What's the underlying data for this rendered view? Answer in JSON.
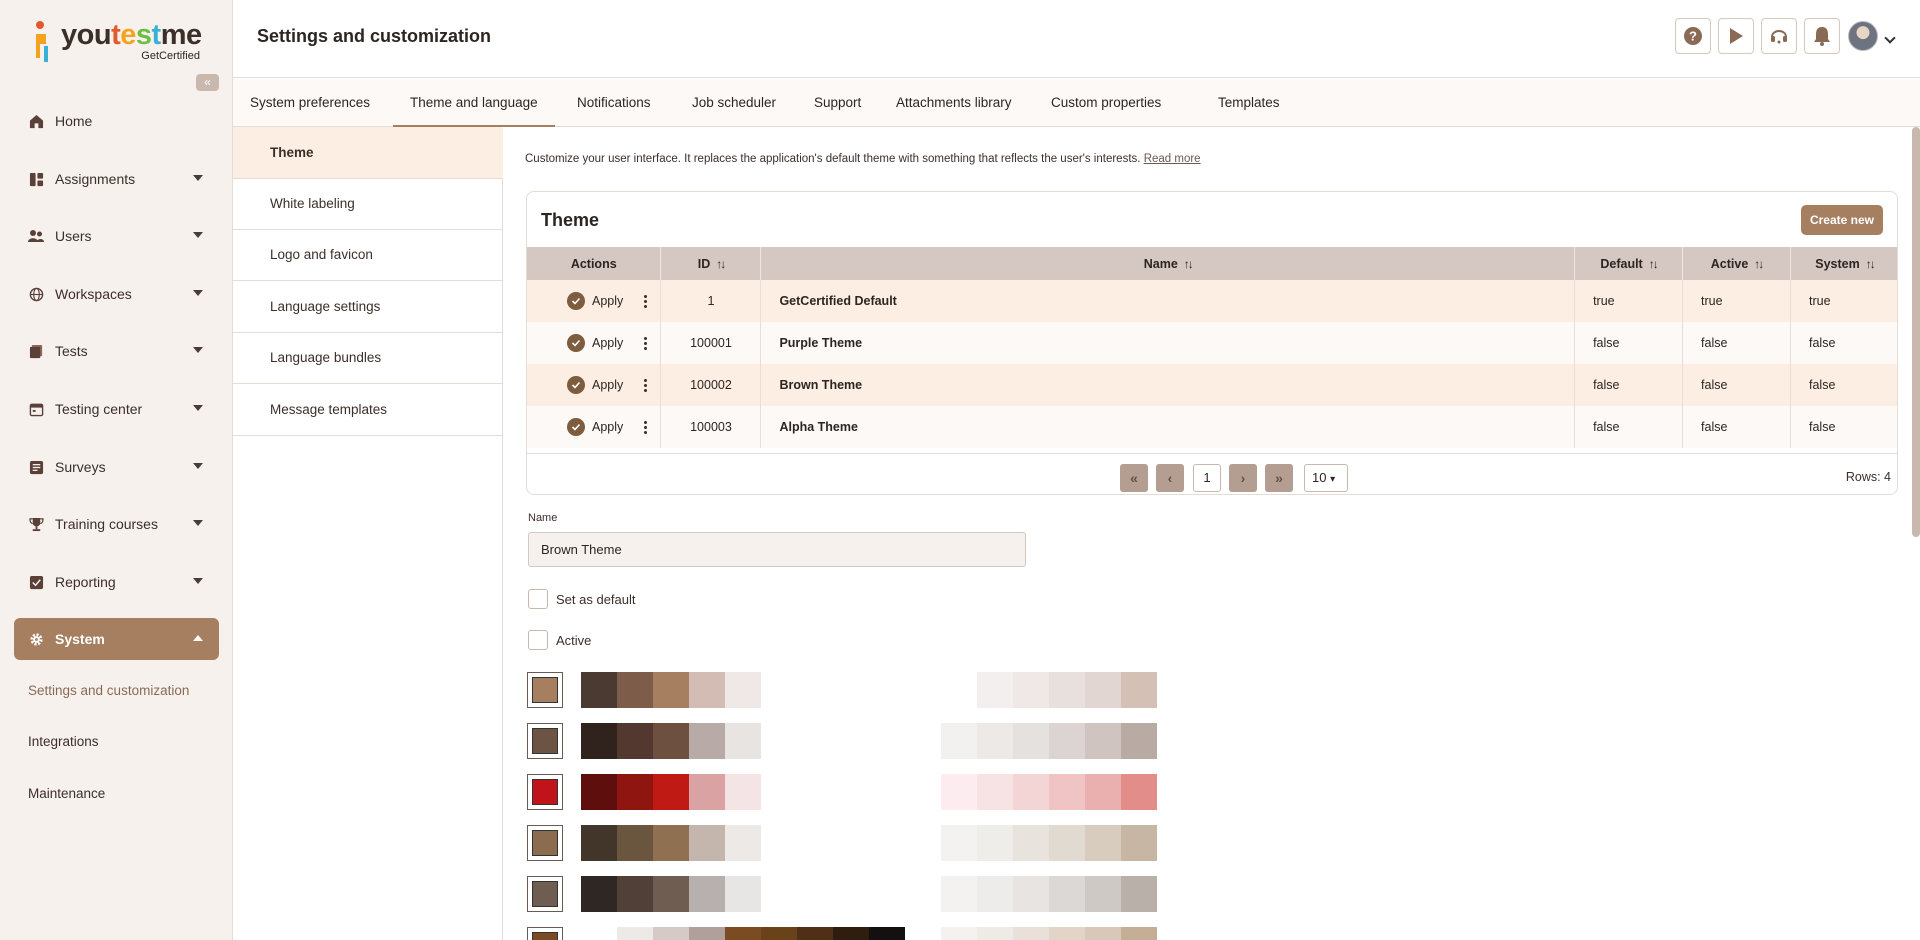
{
  "logo": {
    "text": "youtestme",
    "sub": "GetCertified"
  },
  "sidebar": {
    "items": [
      {
        "label": "Home",
        "icon": "home-icon"
      },
      {
        "label": "Assignments",
        "icon": "assignments-icon"
      },
      {
        "label": "Users",
        "icon": "users-icon"
      },
      {
        "label": "Workspaces",
        "icon": "globe-icon"
      },
      {
        "label": "Tests",
        "icon": "tests-icon"
      },
      {
        "label": "Testing center",
        "icon": "calendar-icon"
      },
      {
        "label": "Surveys",
        "icon": "survey-icon"
      },
      {
        "label": "Training courses",
        "icon": "trophy-icon"
      },
      {
        "label": "Reporting",
        "icon": "reporting-icon"
      },
      {
        "label": "System",
        "icon": "gear-icon"
      }
    ],
    "system_sub": [
      "Settings and customization",
      "Integrations",
      "Maintenance"
    ]
  },
  "header": {
    "title": "Settings and customization"
  },
  "tabs": [
    "System preferences",
    "Theme and language",
    "Notifications",
    "Job scheduler",
    "Support",
    "Attachments library",
    "Custom properties",
    "Templates"
  ],
  "subnav": [
    "Theme",
    "White labeling",
    "Logo and favicon",
    "Language settings",
    "Language bundles",
    "Message templates"
  ],
  "desc": {
    "text": "Customize your user interface. It replaces the application's default theme with something that reflects the user's interests.",
    "link": "Read more"
  },
  "theme_card": {
    "title": "Theme",
    "create_label": "Create new",
    "columns": [
      "Actions",
      "ID",
      "Name",
      "Default",
      "Active",
      "System"
    ],
    "apply_label": "Apply",
    "rows": [
      {
        "id": "1",
        "name": "GetCertified Default",
        "default": "true",
        "active": "true",
        "system": "true"
      },
      {
        "id": "100001",
        "name": "Purple Theme",
        "default": "false",
        "active": "false",
        "system": "false"
      },
      {
        "id": "100002",
        "name": "Brown Theme",
        "default": "false",
        "active": "false",
        "system": "false"
      },
      {
        "id": "100003",
        "name": "Alpha Theme",
        "default": "false",
        "active": "false",
        "system": "false"
      }
    ],
    "page": "1",
    "page_size": "10",
    "rows_count": "Rows: 4"
  },
  "form": {
    "name_label": "Name",
    "name_value": "Brown Theme",
    "set_default_label": "Set as default",
    "active_label": "Active"
  },
  "palettes": [
    {
      "main": "#a67f61",
      "dark": [
        "#4a3a31",
        "#7d5d49",
        "#a67f61",
        "#d2bcb3",
        "#efe8e6"
      ],
      "light": [
        "#f3efee",
        "#efe8e6",
        "#e7e0dd",
        "#e1d6d1",
        "#d5c0b5"
      ]
    },
    {
      "main": "#6d5344",
      "dark": [
        "#30231e",
        "#53382f",
        "#6d5040",
        "#b8aaa6",
        "#e8e4e2"
      ],
      "light": [
        "#f3f1f0",
        "#ece9e7",
        "#e5e1df",
        "#dbd4d2",
        "#cfc4c0",
        "#b9aaa4"
      ]
    },
    {
      "main": "#c0141a",
      "dark": [
        "#5e0e0c",
        "#8f1511",
        "#c01a14",
        "#dba2a4",
        "#f5e4e5"
      ],
      "light": [
        "#fcecef",
        "#f7e3e4",
        "#f4d5d6",
        "#f0c4c5",
        "#eaafaf",
        "#e28d89"
      ]
    },
    {
      "main": "#8b6c4e",
      "dark": [
        "#42352a",
        "#6a553f",
        "#8f7152",
        "#c5b6ad",
        "#ece9e7"
      ],
      "light": [
        "#f3f2f0",
        "#efede9",
        "#e8e3dd",
        "#e1dad1",
        "#d8ccbf",
        "#c7b6a4"
      ]
    },
    {
      "main": "#6f5d52",
      "dark": [
        "#2f2724",
        "#504038",
        "#6f5d52",
        "#b7b0ae",
        "#e8e6e5"
      ],
      "light": [
        "#f3f2f1",
        "#eeecea",
        "#e7e4e2",
        "#dcd8d6",
        "#cfc9c6",
        "#bab0aa"
      ]
    },
    {
      "main": "#7a4b23",
      "dark": [
        "#ffffff",
        "#ece9e7",
        "#d5cac6",
        "#b0a09b",
        "#7b4b21",
        "#6a4219",
        "#4e3017",
        "#2f1d0f",
        "#151010"
      ],
      "light": [
        "#f4f1ef",
        "#eeeae6",
        "#e8e0d9",
        "#e2d5c8",
        "#d7c8ba",
        "#c5ae96"
      ]
    }
  ]
}
